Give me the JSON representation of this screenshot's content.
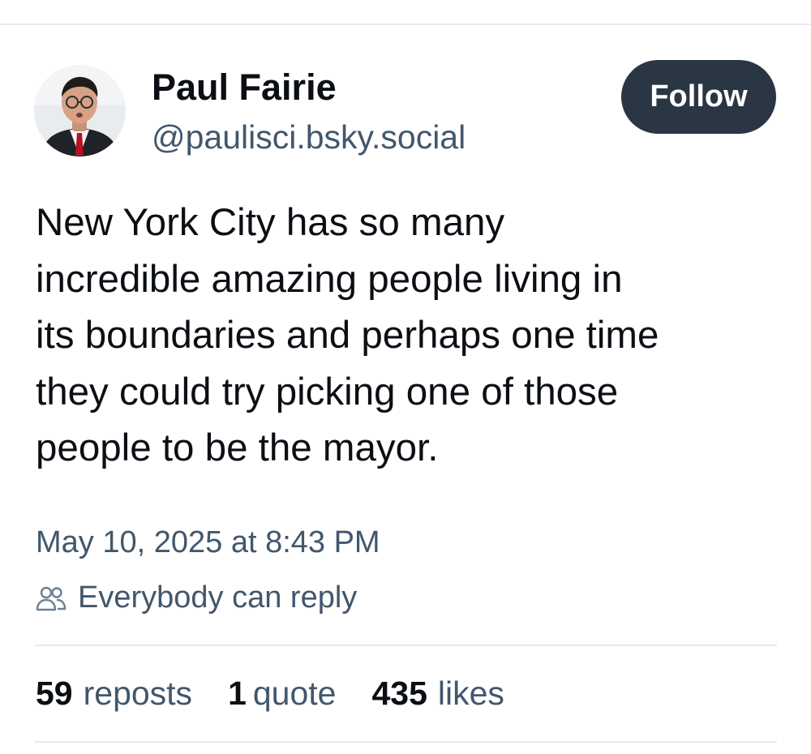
{
  "author": {
    "name": "Paul Fairie",
    "handle": "@paulisci.bsky.social"
  },
  "follow_button": {
    "label": "Follow"
  },
  "post": {
    "text_lines": [
      "New York City has so many",
      "incredible amazing people living in",
      "its boundaries and perhaps one time",
      "they could try picking one of those",
      "people to be the mayor."
    ],
    "timestamp": "May 10, 2025 at 8:43 PM",
    "reply_setting": {
      "label": "Everybody can reply",
      "icon": "people-icon"
    }
  },
  "stats": {
    "reposts": {
      "count": "59",
      "label": "reposts"
    },
    "quotes": {
      "count": "1",
      "label": "quote"
    },
    "likes": {
      "count": "435",
      "label": "likes"
    }
  },
  "colors": {
    "primary_text": "#0b0f14",
    "secondary_text": "#42576c",
    "follow_button_bg": "#2a3644",
    "divider": "#e8ebee"
  }
}
